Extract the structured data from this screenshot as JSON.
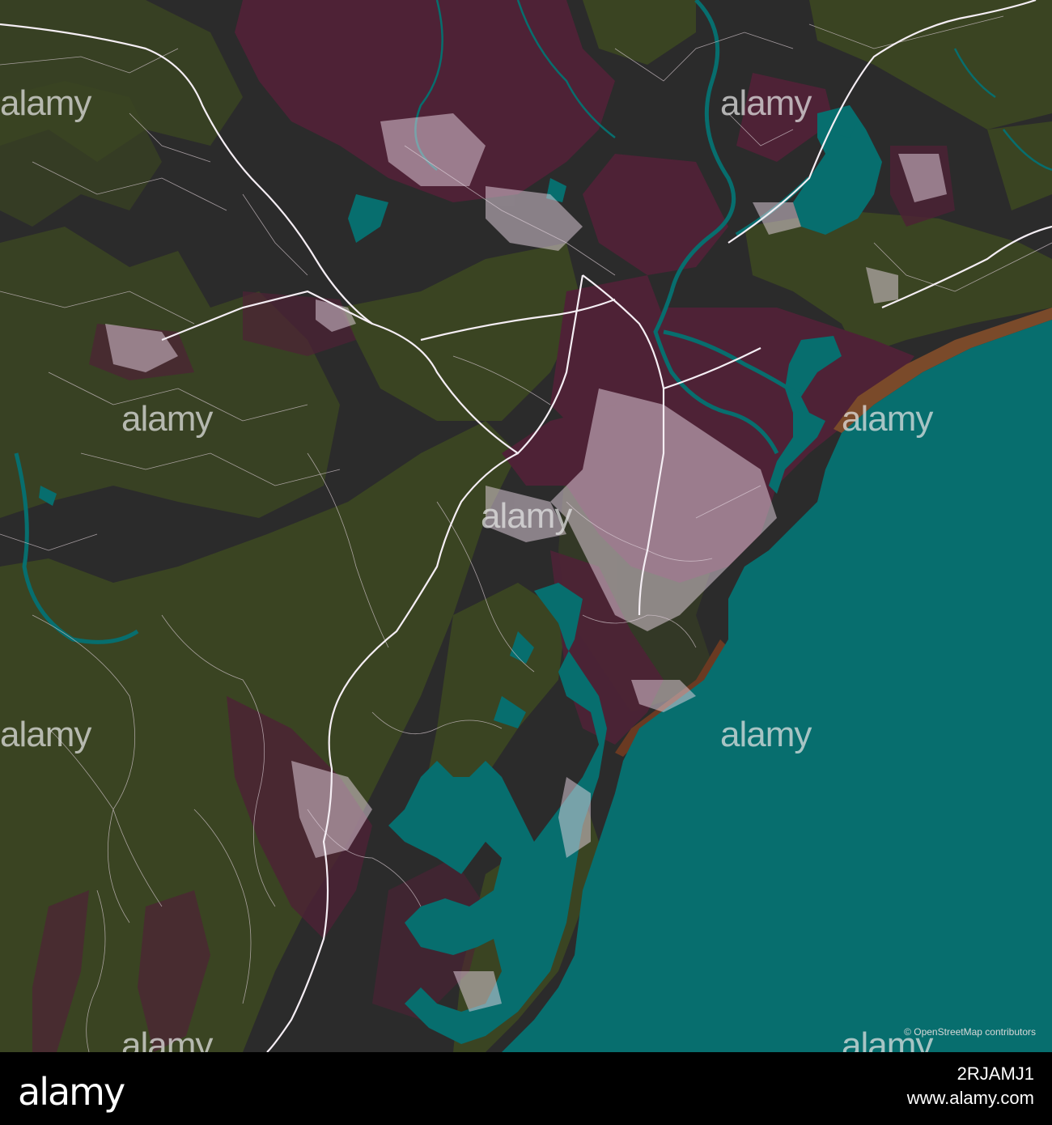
{
  "colors": {
    "background_land": "#2b2b2b",
    "vegetation": "#3a4422",
    "residential": "#4e2236",
    "water": "#076e6e",
    "roads": "#f0e0ee",
    "beach": "#7a4a2a",
    "footer": "#000000"
  },
  "map": {
    "attribution": "© OpenStreetMap contributors"
  },
  "watermarks": [
    "alamy",
    "alamy",
    "alamy",
    "alamy",
    "alamy",
    "alamy",
    "alamy",
    "alamy",
    "alamy",
    "alamy"
  ],
  "footer": {
    "logo": "alamy",
    "image_id": "2RJAMJ1",
    "site": "www.alamy.com"
  }
}
